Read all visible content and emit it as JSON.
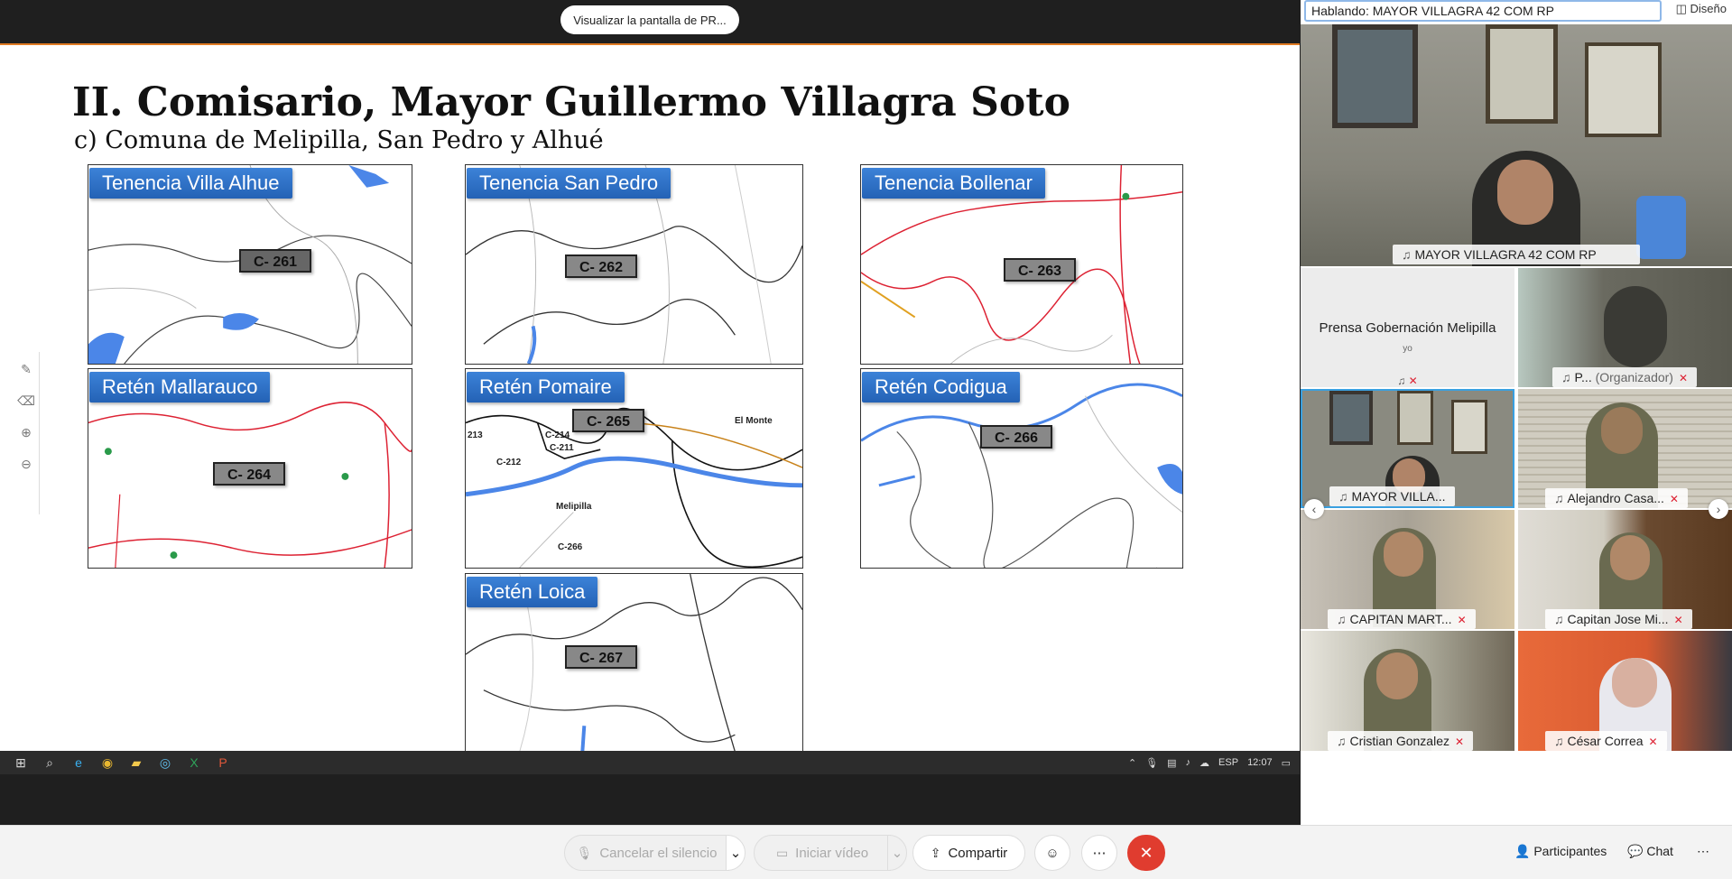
{
  "share_pill": "Visualizar la pantalla de PR...",
  "slide": {
    "title": "II. Comisario, Mayor Guillermo Villagra Soto",
    "subtitle": "c) Comuna de Melipilla, San Pedro y Alhué",
    "maps": [
      {
        "label": "Tenencia Villa Alhue",
        "code": "C- 261"
      },
      {
        "label": "Tenencia San Pedro",
        "code": "C- 262"
      },
      {
        "label": "Tenencia Bollenar",
        "code": "C- 263"
      },
      {
        "label": "Retén Mallarauco",
        "code": "C- 264"
      },
      {
        "label": "Retén Pomaire",
        "code": "C- 265"
      },
      {
        "label": "Retén Codigua",
        "code": "C- 266"
      },
      {
        "label": "Retén Loica",
        "code": "C- 267"
      }
    ],
    "pomaire_places": {
      "monte": "El Monte",
      "melipilla": "Melipilla",
      "c266": "C-266",
      "c212": "C-212",
      "c211": "C-211",
      "c214": "C-214",
      "n213": "213"
    }
  },
  "taskbar": {
    "lang": "ESP",
    "time": "12:07"
  },
  "panel": {
    "speaking_label": "Hablando:",
    "speaking_name": "MAYOR VILLAGRA 42 COM RP",
    "design": "Diseño",
    "main_name": "MAYOR VILLAGRA 42 COM RP",
    "me": {
      "name": "Prensa Gobernación Melipilla",
      "sub": "yo"
    },
    "participants": [
      {
        "name": "P...",
        "extra": "(Organizador)"
      },
      {
        "name": "MAYOR VILLA..."
      },
      {
        "name": "Alejandro Casa..."
      },
      {
        "name": "CAPITAN MART..."
      },
      {
        "name": "Capitan Jose Mi..."
      },
      {
        "name": "Cristian Gonzalez"
      },
      {
        "name": "César Correa"
      }
    ]
  },
  "controls": {
    "unmute": "Cancelar el silencio",
    "video": "Iniciar vídeo",
    "share": "Compartir",
    "participants": "Participantes",
    "chat": "Chat"
  },
  "icons": [
    "pen-icon",
    "eraser-icon",
    "zoom-in-icon",
    "zoom-out-icon",
    "windows-icon",
    "search-icon",
    "edge-icon",
    "chrome-icon",
    "folder-icon",
    "browser-icon",
    "excel-icon",
    "powerpoint-icon",
    "mic-icon",
    "video-icon",
    "share-icon",
    "emoji-icon",
    "more-icon",
    "close-icon",
    "people-icon",
    "chat-icon"
  ]
}
